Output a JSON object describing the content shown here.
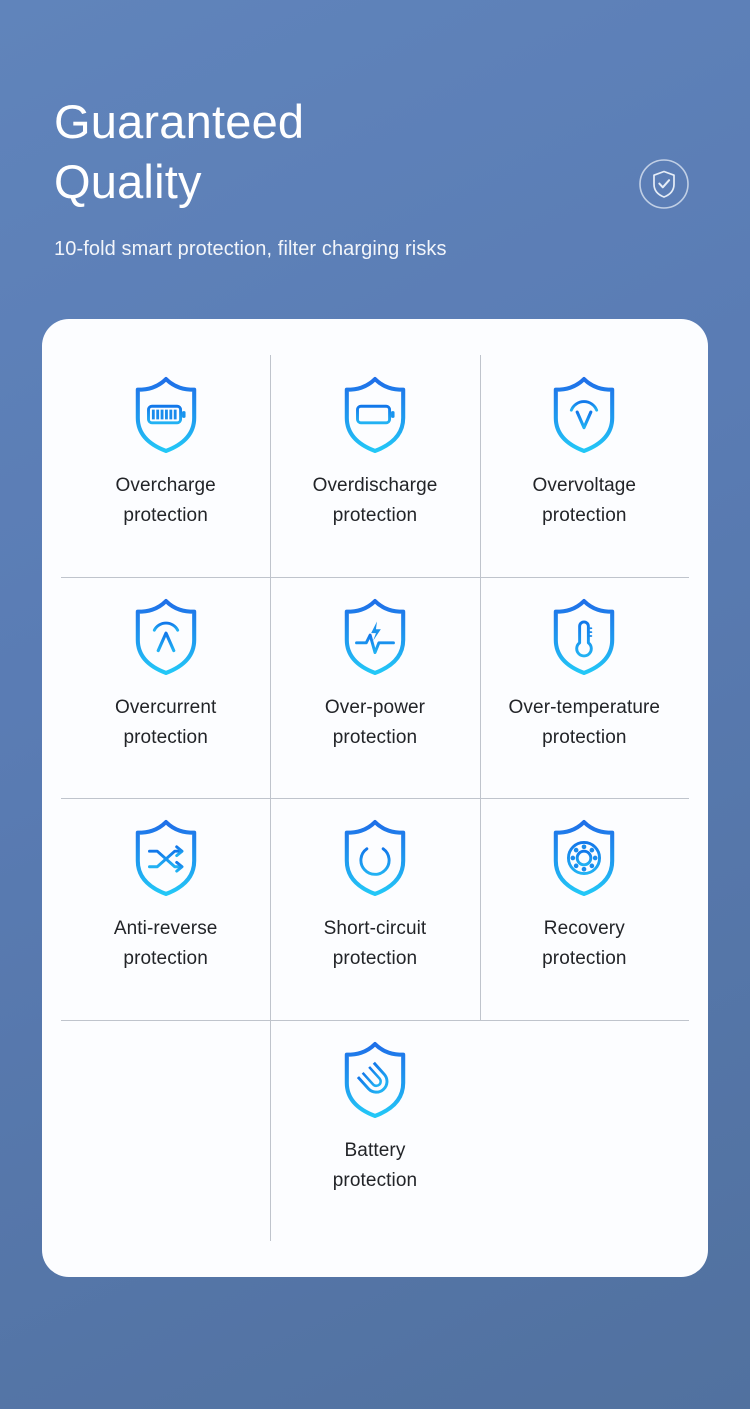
{
  "header": {
    "title": "Guaranteed\nQuality",
    "subtitle": "10-fold smart protection, filter charging risks",
    "badge_icon": "shield-check-icon"
  },
  "colors": {
    "background": "#5a7cb4",
    "card": "#fcfdff",
    "divider": "#bfc4cc",
    "icon_gradient_top": "#1f6fe8",
    "icon_gradient_bottom": "#23c0f5",
    "title_text": "#ffffff",
    "label_text": "#222428"
  },
  "card": {
    "items": [
      {
        "icon": "shield-full-battery-icon",
        "label": "Overcharge\nprotection"
      },
      {
        "icon": "shield-empty-battery-icon",
        "label": "Overdischarge\nprotection"
      },
      {
        "icon": "shield-voltage-v-icon",
        "label": "Overvoltage\nprotection"
      },
      {
        "icon": "shield-current-a-icon",
        "label": "Overcurrent\nprotection"
      },
      {
        "icon": "shield-power-pulse-icon",
        "label": "Over-power\nprotection"
      },
      {
        "icon": "shield-thermometer-icon",
        "label": "Over-temperature\nprotection"
      },
      {
        "icon": "shield-shuffle-arrows-icon",
        "label": "Anti-reverse\nprotection"
      },
      {
        "icon": "shield-power-button-icon",
        "label": "Short-circuit\nprotection"
      },
      {
        "icon": "shield-hub-nodes-icon",
        "label": "Recovery\nprotection"
      },
      {
        "icon": "shield-magnet-icon",
        "label": "Battery\nprotection"
      }
    ]
  }
}
